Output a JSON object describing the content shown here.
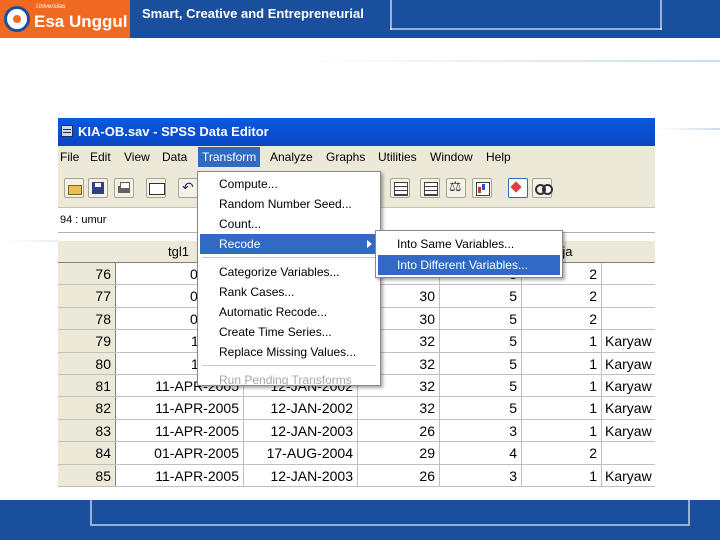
{
  "header": {
    "logo_sub": "Universitas",
    "logo_name": "Esa Unggul",
    "tagline": "Smart, Creative and Entrepreneurial"
  },
  "window": {
    "title": "KIA-OB.sav - SPSS Data Editor",
    "menus": [
      "File",
      "Edit",
      "View",
      "Data",
      "Transform",
      "Analyze",
      "Graphs",
      "Utilities",
      "Window",
      "Help"
    ],
    "active_menu": "Transform",
    "cell_ref": "94 : umur"
  },
  "toolbar": {
    "icons": [
      "open-icon",
      "save-icon",
      "print-icon",
      "dialog-recall-icon",
      "undo-icon",
      "goto-case-icon",
      "variables-icon",
      "find-icon",
      "insert-cases-icon",
      "insert-variable-icon",
      "split-file-icon",
      "weight-cases-icon",
      "select-cases-icon",
      "value-labels-icon",
      "use-sets-icon"
    ]
  },
  "grid": {
    "columns": [
      "tgl1",
      "",
      "",
      "",
      "rja",
      ""
    ],
    "rows": [
      {
        "n": "76",
        "tgl1": "01-APR",
        "tgl2": "",
        "c3": "",
        "c4": "5",
        "kerja": "2",
        "text": ""
      },
      {
        "n": "77",
        "tgl1": "01-APR",
        "tgl2": "",
        "c3": "30",
        "c4": "5",
        "kerja": "2",
        "text": ""
      },
      {
        "n": "78",
        "tgl1": "01-APR",
        "tgl2": "",
        "c3": "30",
        "c4": "5",
        "kerja": "2",
        "text": ""
      },
      {
        "n": "79",
        "tgl1": "11-APR",
        "tgl2": "",
        "c3": "32",
        "c4": "5",
        "kerja": "1",
        "text": "Karyaw"
      },
      {
        "n": "80",
        "tgl1": "11-APR",
        "tgl2": "",
        "c3": "32",
        "c4": "5",
        "kerja": "1",
        "text": "Karyaw"
      },
      {
        "n": "81",
        "tgl1": "11-APR-2005",
        "tgl2": "12-JAN-2002",
        "c3": "32",
        "c4": "5",
        "kerja": "1",
        "text": "Karyaw"
      },
      {
        "n": "82",
        "tgl1": "11-APR-2005",
        "tgl2": "12-JAN-2002",
        "c3": "32",
        "c4": "5",
        "kerja": "1",
        "text": "Karyaw"
      },
      {
        "n": "83",
        "tgl1": "11-APR-2005",
        "tgl2": "12-JAN-2003",
        "c3": "26",
        "c4": "3",
        "kerja": "1",
        "text": "Karyaw"
      },
      {
        "n": "84",
        "tgl1": "01-APR-2005",
        "tgl2": "17-AUG-2004",
        "c3": "29",
        "c4": "4",
        "kerja": "2",
        "text": ""
      },
      {
        "n": "85",
        "tgl1": "11-APR-2005",
        "tgl2": "12-JAN-2003",
        "c3": "26",
        "c4": "3",
        "kerja": "1",
        "text": "Karyaw"
      }
    ]
  },
  "transform_menu": {
    "items": [
      {
        "label": "Compute...",
        "state": "normal"
      },
      {
        "label": "Random Number Seed...",
        "state": "normal"
      },
      {
        "label": "Count...",
        "state": "normal"
      },
      {
        "label": "Recode",
        "state": "selected",
        "submenu": true
      },
      {
        "label": "Categorize Variables...",
        "state": "normal"
      },
      {
        "label": "Rank Cases...",
        "state": "normal"
      },
      {
        "label": "Automatic Recode...",
        "state": "normal"
      },
      {
        "label": "Create Time Series...",
        "state": "normal"
      },
      {
        "label": "Replace Missing Values...",
        "state": "normal"
      },
      {
        "label": "Run Pending Transforms",
        "state": "disabled"
      }
    ]
  },
  "recode_submenu": {
    "items": [
      {
        "label": "Into Same Variables...",
        "state": "normal"
      },
      {
        "label": "Into Different Variables...",
        "state": "selected"
      }
    ]
  },
  "colors": {
    "header_blue": "#1a4f9e",
    "logo_orange": "#f26a21",
    "title_bar_blue": "#0846c4",
    "menu_highlight": "#316ac5"
  }
}
